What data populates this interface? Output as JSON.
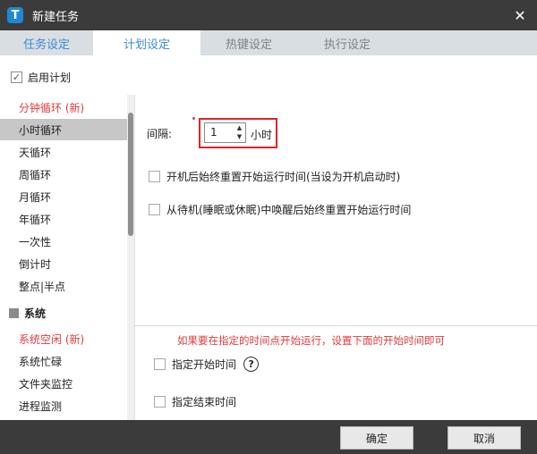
{
  "window": {
    "title": "新建任务",
    "logo_letter": "T",
    "close_glyph": "✕"
  },
  "tabs": [
    {
      "label": "任务设定"
    },
    {
      "label": "计划设定"
    },
    {
      "label": "热键设定"
    },
    {
      "label": "执行设定"
    }
  ],
  "enable_plan": {
    "label": "启用计划",
    "checked": true
  },
  "sidebar": {
    "items": [
      {
        "label": "分钟循环 (新)"
      },
      {
        "label": "小时循环"
      },
      {
        "label": "天循环"
      },
      {
        "label": "周循环"
      },
      {
        "label": "月循环"
      },
      {
        "label": "年循环"
      },
      {
        "label": "一次性"
      },
      {
        "label": "倒计时"
      },
      {
        "label": "整点|半点"
      }
    ],
    "section_header": "系统",
    "section_items": [
      {
        "label": "系统空闲 (新)"
      },
      {
        "label": "系统忙碌"
      },
      {
        "label": "文件夹监控"
      },
      {
        "label": "进程监测"
      }
    ]
  },
  "interval": {
    "label": "间隔:",
    "value": "1",
    "unit": "小时",
    "up_glyph": "▲",
    "down_glyph": "▼"
  },
  "options": {
    "reset_on_boot": "开机后始终重置开始运行时间(当设为开机启动时)",
    "reset_on_wake": "从待机(睡眠或休眠)中唤醒后始终重置开始运行时间"
  },
  "hint": "如果要在指定的时间点开始运行，设置下面的开始时间即可",
  "start_time": {
    "label": "指定开始时间",
    "help_glyph": "?"
  },
  "end_time": {
    "label": "指定结束时间"
  },
  "buttons": {
    "ok": "确定",
    "cancel": "取消"
  }
}
